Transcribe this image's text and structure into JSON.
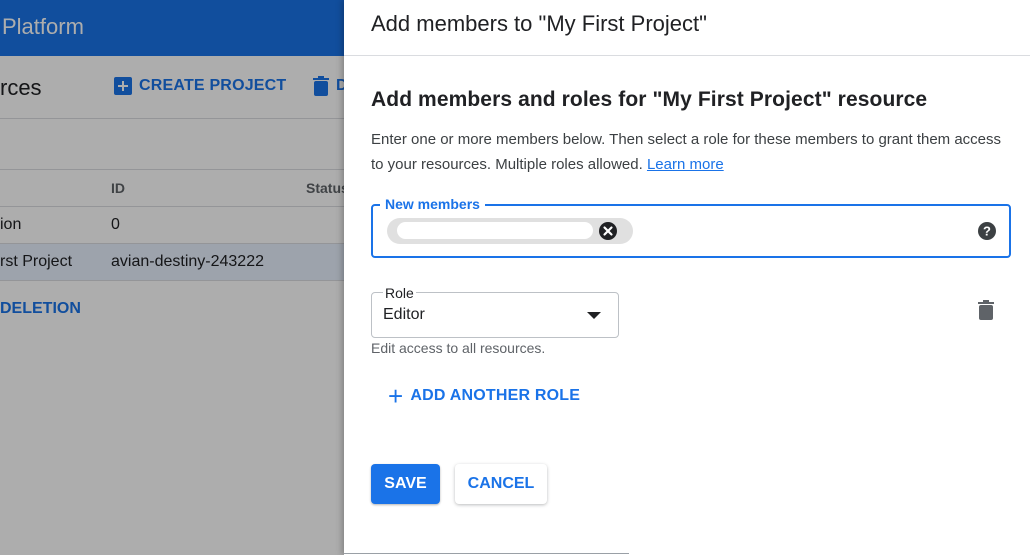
{
  "colors": {
    "accent": "#1a73e8",
    "scrim": "rgba(0,0,0,0.32)",
    "chip": "#e0e0e0"
  },
  "background": {
    "brand": "Platform",
    "page_title": "rces",
    "create_project_label": "CREATE PROJECT",
    "create_project_icon": "add-box-icon",
    "delete_label": "D",
    "delete_icon": "trash-icon",
    "table": {
      "columns": [
        "",
        "ID",
        "Status"
      ],
      "rows": [
        {
          "name": "ion",
          "id": "0"
        },
        {
          "name": "rst Project",
          "id": "avian-destiny-243222",
          "selected": true
        }
      ]
    },
    "pending_deletion_label": "DELETION"
  },
  "panel": {
    "title": "Add members to \"My First Project\"",
    "heading": "Add members and roles for \"My First Project\" resource",
    "description": "Enter one or more members below. Then select a role for these members to grant them access to your resources. Multiple roles allowed.",
    "learn_more": "Learn more",
    "new_members": {
      "label": "New members",
      "chip_redacted": true,
      "chip_close_icon": "close-circle-icon",
      "help_icon": "help-circle-icon"
    },
    "role": {
      "label": "Role",
      "value": "Editor",
      "helper": "Edit access to all resources.",
      "delete_icon": "trash-icon"
    },
    "add_another_role": "ADD ANOTHER ROLE",
    "add_another_role_icon": "plus-icon",
    "save": "SAVE",
    "cancel": "CANCEL"
  }
}
